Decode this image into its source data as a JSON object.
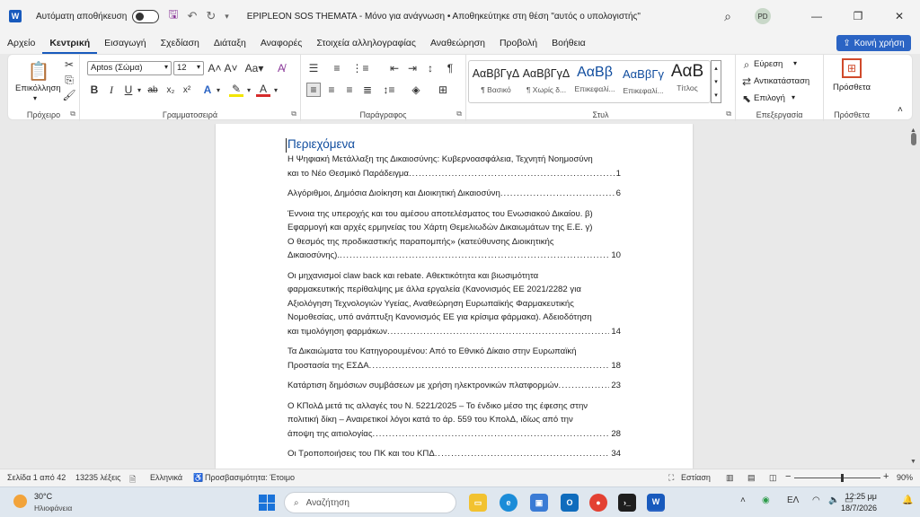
{
  "titlebar": {
    "app_letter": "W",
    "autosave_label": "Αυτόματη αποθήκευση",
    "doc_title": "EPIPLEON SOS THEMATA  -  Μόνο για ανάγνωση  •  Αποθηκεύτηκε στη θέση \"αυτός ο υπολογιστής\"",
    "avatar_initials": "PD"
  },
  "tabs": [
    "Αρχείο",
    "Κεντρική",
    "Εισαγωγή",
    "Σχεδίαση",
    "Διάταξη",
    "Αναφορές",
    "Στοιχεία αλληλογραφίας",
    "Αναθεώρηση",
    "Προβολή",
    "Βοήθεια"
  ],
  "active_tab": "Κεντρική",
  "share_label": "Κοινή χρήση",
  "ribbon": {
    "clipboard": {
      "paste_label": "Επικόλληση",
      "group_label": "Πρόχειρο"
    },
    "font": {
      "font_name": "Aptos (Σώμα)",
      "font_size": "12",
      "group_label": "Γραμματοσειρά"
    },
    "paragraph": {
      "group_label": "Παράγραφος"
    },
    "styles": {
      "group_label": "Στυλ",
      "items": [
        {
          "sample": "ΑαΒβΓγΔ",
          "name": "¶ Βασικό"
        },
        {
          "sample": "ΑαΒβΓγΔ",
          "name": "¶ Χωρίς δ..."
        },
        {
          "sample": "ΑαΒβ",
          "name": "Επικεφαλί..."
        },
        {
          "sample": "ΑαΒβΓγ",
          "name": "Επικεφαλί..."
        },
        {
          "sample": "ΑαΒ",
          "name": "Τίτλος"
        }
      ]
    },
    "editing": {
      "find": "Εύρεση",
      "replace": "Αντικατάσταση",
      "select": "Επιλογή",
      "group_label": "Επεξεργασία"
    },
    "addins": {
      "label": "Πρόσθετα",
      "group_label": "Πρόσθετα"
    }
  },
  "document": {
    "toc_heading": "Περιεχόμενα",
    "toc": [
      {
        "lines": [
          "Η Ψηφιακή Μετάλλαξη της Δικαιοσύνης: Κυβερνοασφάλεια, Τεχνητή Νοημοσύνη"
        ],
        "last": "και το Νέο Θεσμικό Παράδειγμα",
        "page": "1"
      },
      {
        "lines": [],
        "last": "Αλγόριθμοι, Δημόσια Διοίκηση και Διοικητική Δικαιοσύνη",
        "page": "6"
      },
      {
        "lines": [
          "Έννοια της υπεροχής και του αμέσου αποτελέσματος του Ενωσιακού Δικαίου. β)",
          "Εφαρμογή και αρχές ερμηνείας του Χάρτη Θεμελιωδών Δικαιωμάτων της Ε.Ε. γ)",
          "Ο θεσμός της προδικαστικής παραπομπής» (κατεύθυνσης Διοικητικής"
        ],
        "last": "Δικαιοσύνης).",
        "page": "10"
      },
      {
        "lines": [
          "Οι μηχανισμοί claw back και rebate. Αθεκτικότητα και βιωσιμότητα",
          "φαρμακευτικής περίθαλψης με άλλα εργαλεία (Κανονισμός ΕΕ 2021/2282 για",
          "Αξιολόγηση Τεχνολογιών Υγείας, Αναθεώρηση Ευρωπαϊκής Φαρμακευτικής",
          "Νομοθεσίας, υπό ανάπτυξη Κανονισμός ΕΕ για κρίσιμα φάρμακα). Αδειοδότηση"
        ],
        "last": "και τιμολόγηση φαρμάκων",
        "page": "14"
      },
      {
        "lines": [
          "Τα Δικαιώματα του Κατηγορουμένου: Από το Εθνικό Δίκαιο στην Ευρωπαϊκή"
        ],
        "last": "Προστασία της ΕΣΔΑ",
        "page": "18"
      },
      {
        "lines": [],
        "last": "Κατάρτιση δημόσιων συμβάσεων με χρήση ηλεκτρονικών πλατφορμών",
        "page": "23"
      },
      {
        "lines": [
          "Ο ΚΠολΔ μετά τις αλλαγές του Ν. 5221/2025 – Το ένδικο μέσο της έφεσης στην",
          "πολιτική δίκη – Αναιρετικοί λόγοι κατά το άρ. 559 του ΚπολΔ, ιδίως από την"
        ],
        "last": "άποψη της αιτιολογίας",
        "page": "28"
      },
      {
        "lines": [],
        "last": "Οι Τροποποιήσεις του ΠΚ και του ΚΠΔ",
        "page": "34"
      }
    ]
  },
  "statusbar": {
    "page": "Σελίδα 1 από 42",
    "words": "13235 λέξεις",
    "language": "Ελληνικά",
    "accessibility": "Προσβασιμότητα: Έτοιμο",
    "focus": "Εστίαση",
    "zoom": "90%"
  },
  "taskbar": {
    "temp": "30°C",
    "weather": "Ηλιοφάνεια",
    "search_placeholder": "Αναζήτηση",
    "lang": "ΕΛ",
    "time": "12:25 μμ",
    "date": "18/7/2026"
  }
}
